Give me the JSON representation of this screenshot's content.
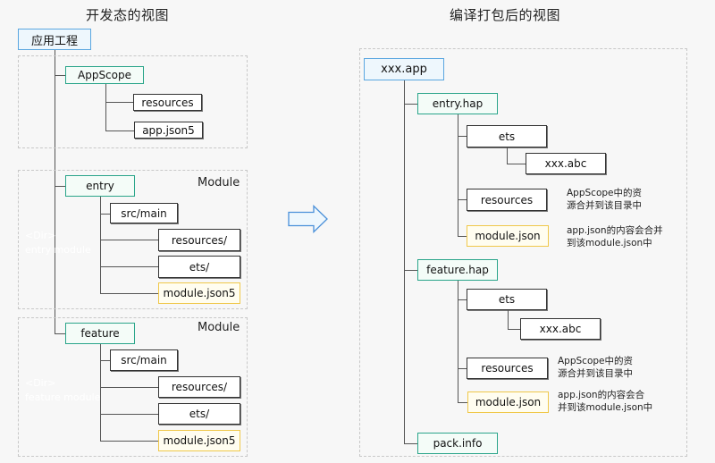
{
  "left": {
    "title": "开发态的视图",
    "root": "应用工程",
    "appscope": {
      "name": "AppScope",
      "children": [
        "resources",
        "app.json5"
      ]
    },
    "modules": [
      {
        "label": "Module",
        "ghost_line1": "<Dir>",
        "ghost_line2": "entry module",
        "name": "entry",
        "src": "src/main",
        "children": [
          "resources/",
          "ets/",
          "module.json5"
        ]
      },
      {
        "label": "Module",
        "ghost_line1": "<Dir>",
        "ghost_line2": "feature module",
        "name": "feature",
        "src": "src/main",
        "children": [
          "resources/",
          "ets/",
          "module.json5"
        ]
      }
    ]
  },
  "arrow": {
    "icon": "right-arrow-icon",
    "fill": "#eef7fd",
    "stroke": "#4a90d9"
  },
  "right": {
    "title": "编译打包后的视图",
    "root": "xxx.app",
    "haps": [
      {
        "name": "entry.hap",
        "ets": "ets",
        "abc": "xxx.abc",
        "resources": "resources",
        "resources_note_1": "AppScope中的资",
        "resources_note_2": "源合并到该目录中",
        "module_json": "module.json",
        "module_note_1": "app.json的内容会合并",
        "module_note_2": "到该module.json中"
      },
      {
        "name": "feature.hap",
        "ets": "ets",
        "abc": "xxx.abc",
        "resources": "resources",
        "resources_note_1": "AppScope中的资",
        "resources_note_2": "源合并到该目录中",
        "module_json": "module.json",
        "module_note_1": "app.json的内容会合",
        "module_note_2": "并到该module.json中"
      }
    ],
    "pack_info": "pack.info"
  },
  "colors": {
    "root_border": "#5aa6e0",
    "module_border": "#2aa58a",
    "json_border": "#f0c84a",
    "file_border": "#333333"
  }
}
